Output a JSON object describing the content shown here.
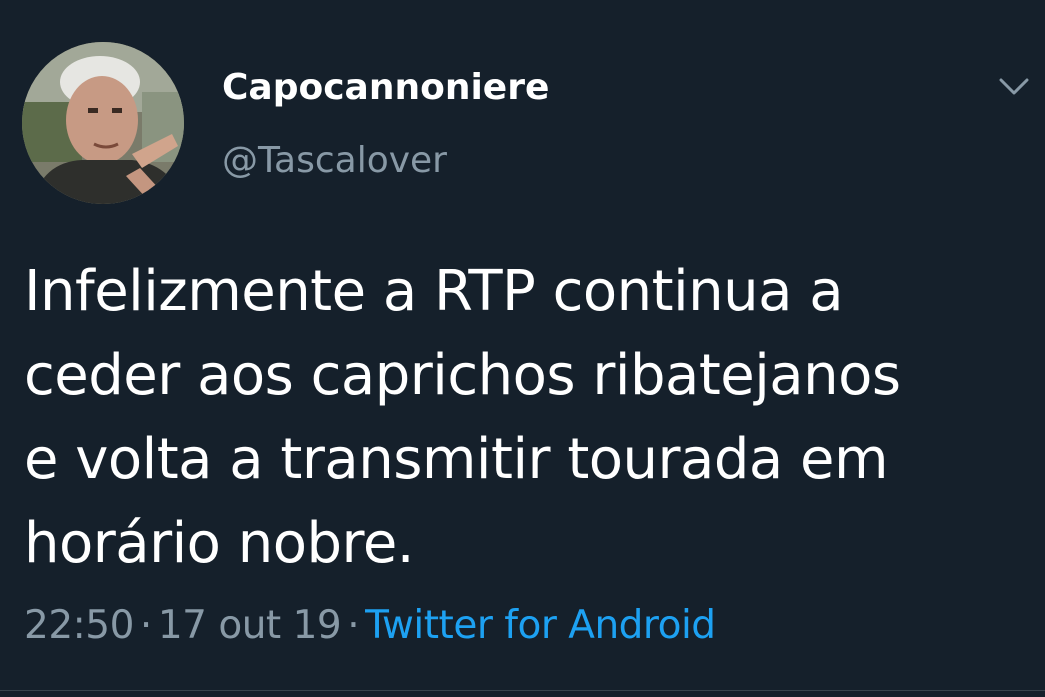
{
  "author": {
    "name": "Capocannoniere",
    "handle": "@Tascalover"
  },
  "tweet": {
    "lines": [
      "Infelizmente a RTP continua a",
      "ceder aos caprichos ribatejanos",
      "e volta a transmitir tourada em",
      "horário nobre."
    ]
  },
  "meta": {
    "time": "22:50",
    "date": "17 out 19",
    "separator": "·",
    "source": "Twitter for Android"
  },
  "icons": {
    "menu": "chevron-down-icon",
    "avatar": "profile-photo"
  },
  "colors": {
    "background": "#15202b",
    "text": "#ffffff",
    "secondary": "#8899a6",
    "link": "#1da1f2"
  }
}
